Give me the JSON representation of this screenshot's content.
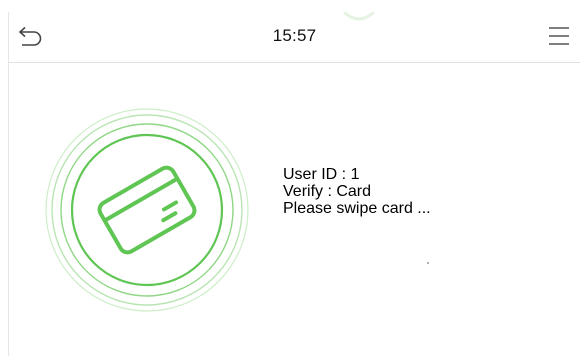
{
  "header": {
    "time": "15:57",
    "back_icon": "back-arrow-icon",
    "menu_icon": "hamburger-menu-icon"
  },
  "verification": {
    "user_id_line": "User ID : 1",
    "verify_line": "Verify : Card",
    "prompt_line": "Please swipe card ...",
    "icon": "card-icon"
  },
  "colors": {
    "accent": "#5fc553",
    "ring_light": "#b9e5b3",
    "icon_gray": "#333333"
  }
}
